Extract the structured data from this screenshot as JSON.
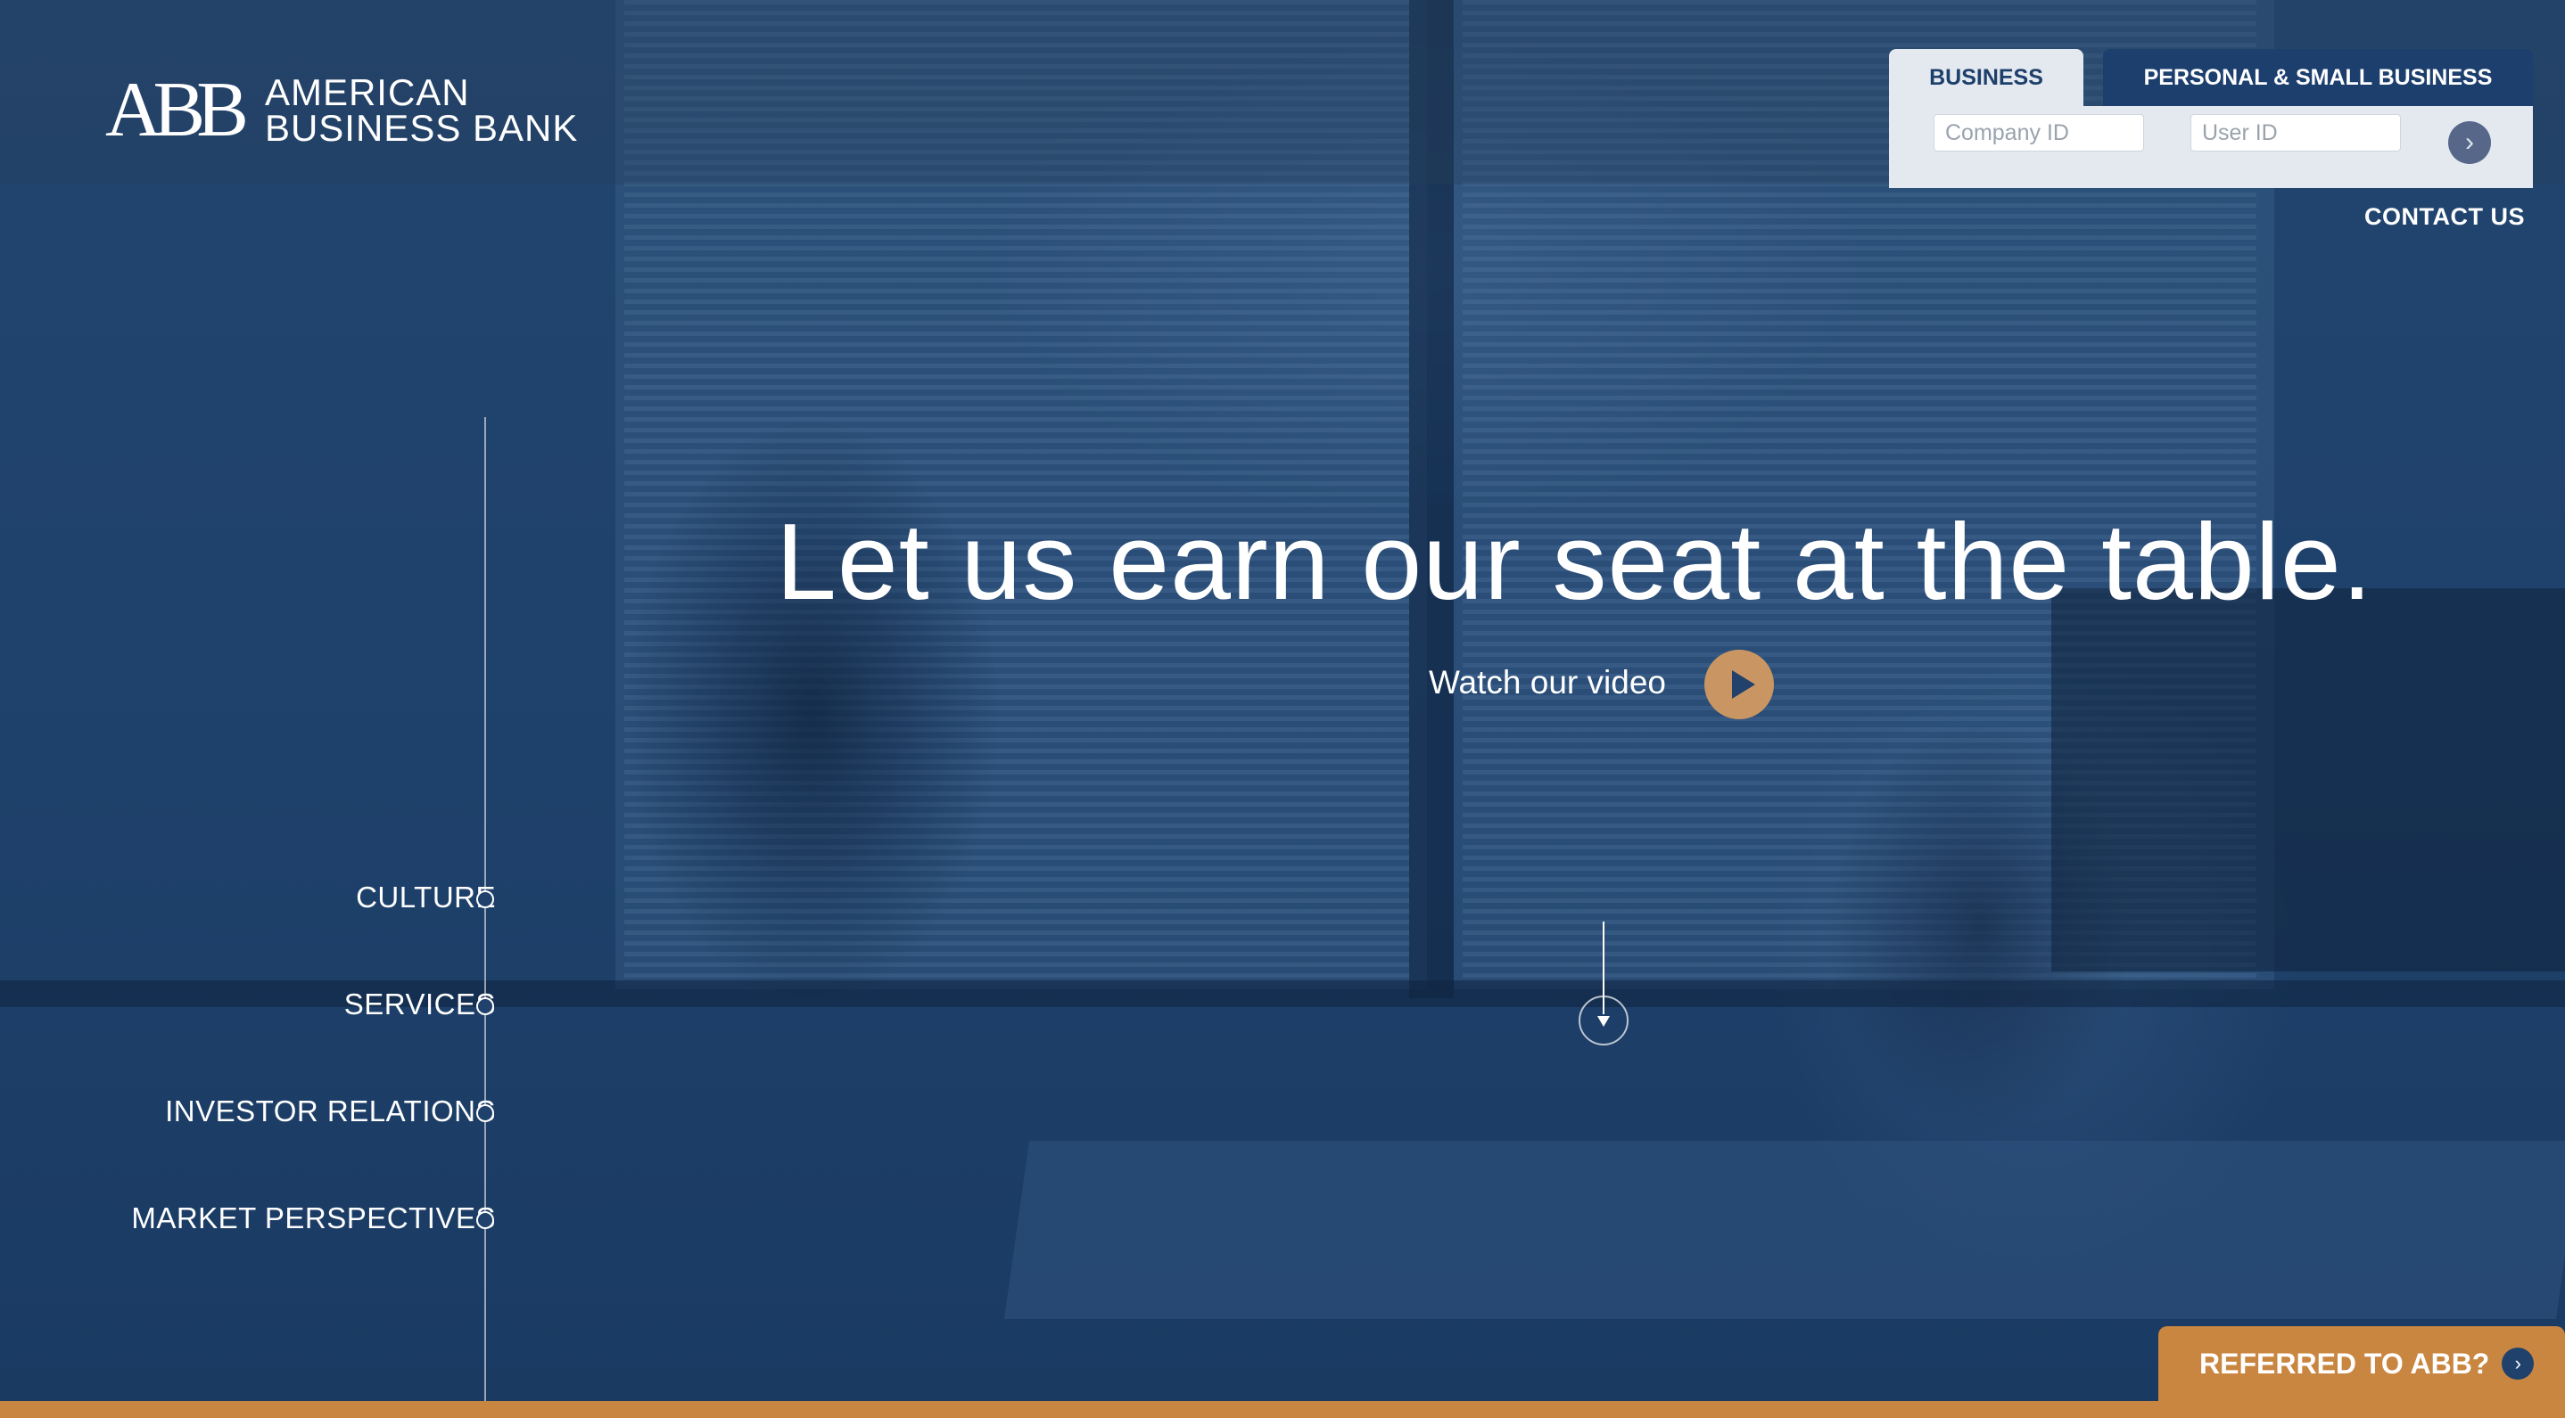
{
  "logo": {
    "mark": "ABB",
    "line1": "AMERICAN",
    "line2": "BUSINESS BANK"
  },
  "login": {
    "tabs": [
      {
        "label": "BUSINESS",
        "active": true
      },
      {
        "label": "PERSONAL & SMALL BUSINESS",
        "active": false
      }
    ],
    "company_id_placeholder": "Company ID",
    "user_id_placeholder": "User ID",
    "submit_icon": "chevron-right-icon"
  },
  "header": {
    "contact_label": "CONTACT US"
  },
  "side_nav": {
    "items": [
      {
        "label": "CULTURE"
      },
      {
        "label": "SERVICES"
      },
      {
        "label": "INVESTOR RELATIONS"
      },
      {
        "label": "MARKET PERSPECTIVES"
      }
    ]
  },
  "hero": {
    "headline": "Let us earn our seat at the table.",
    "video_label": "Watch our video",
    "play_icon": "play-icon",
    "scroll_icon": "scroll-down-icon"
  },
  "referral": {
    "label": "REFERRED TO ABB?",
    "icon": "chevron-right-icon"
  },
  "colors": {
    "navy": "#1d3f6b",
    "accent_orange": "#c98641",
    "play_button": "#c99663",
    "panel_light": "#e4e9ef"
  }
}
